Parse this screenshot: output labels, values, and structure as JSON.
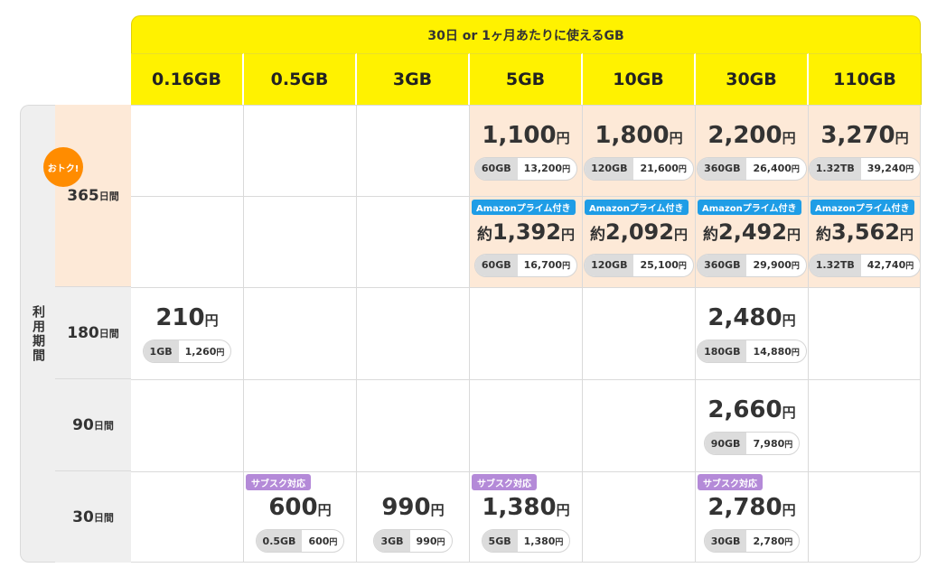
{
  "header": "30日 or 1ヶ月あたりに使えるGB",
  "sizes": [
    "0.16GB",
    "0.5GB",
    "3GB",
    "5GB",
    "10GB",
    "30GB",
    "110GB"
  ],
  "usage_label": "利用期間",
  "otoku": "おトク!",
  "amazon_tag": "Amazonプライム付き",
  "sub_tag": "サブスク対応",
  "yen": "円",
  "approx": "約",
  "durations": [
    {
      "num": "365",
      "unit": "日間"
    },
    {
      "num": "180",
      "unit": "日間"
    },
    {
      "num": "90",
      "unit": "日間"
    },
    {
      "num": "30",
      "unit": "日間"
    }
  ],
  "plans": {
    "d365_5gb": {
      "price": "1,100",
      "data": "60GB",
      "total": "13,200"
    },
    "d365_10gb": {
      "price": "1,800",
      "data": "120GB",
      "total": "21,600"
    },
    "d365_30gb": {
      "price": "2,200",
      "data": "360GB",
      "total": "26,400"
    },
    "d365_110gb": {
      "price": "3,270",
      "data": "1.32TB",
      "total": "39,240"
    },
    "d365a_5gb": {
      "price": "1,392",
      "data": "60GB",
      "total": "16,700"
    },
    "d365a_10gb": {
      "price": "2,092",
      "data": "120GB",
      "total": "25,100"
    },
    "d365a_30gb": {
      "price": "2,492",
      "data": "360GB",
      "total": "29,900"
    },
    "d365a_110gb": {
      "price": "3,562",
      "data": "1.32TB",
      "total": "42,740"
    },
    "d180_016gb": {
      "price": "210",
      "data": "1GB",
      "total": "1,260"
    },
    "d180_30gb": {
      "price": "2,480",
      "data": "180GB",
      "total": "14,880"
    },
    "d90_30gb": {
      "price": "2,660",
      "data": "90GB",
      "total": "7,980"
    },
    "d30_05gb": {
      "price": "600",
      "data": "0.5GB",
      "total": "600"
    },
    "d30_3gb": {
      "price": "990",
      "data": "3GB",
      "total": "990"
    },
    "d30_5gb": {
      "price": "1,380",
      "data": "5GB",
      "total": "1,380"
    },
    "d30_30gb": {
      "price": "2,780",
      "data": "30GB",
      "total": "2,780"
    }
  },
  "colors": {
    "header_yellow": "#fff200",
    "highlight": "#fde9d7",
    "amazon_blue": "#1f9de6",
    "sub_purple": "#b48ad8",
    "badge_orange": "#ff8c00"
  }
}
